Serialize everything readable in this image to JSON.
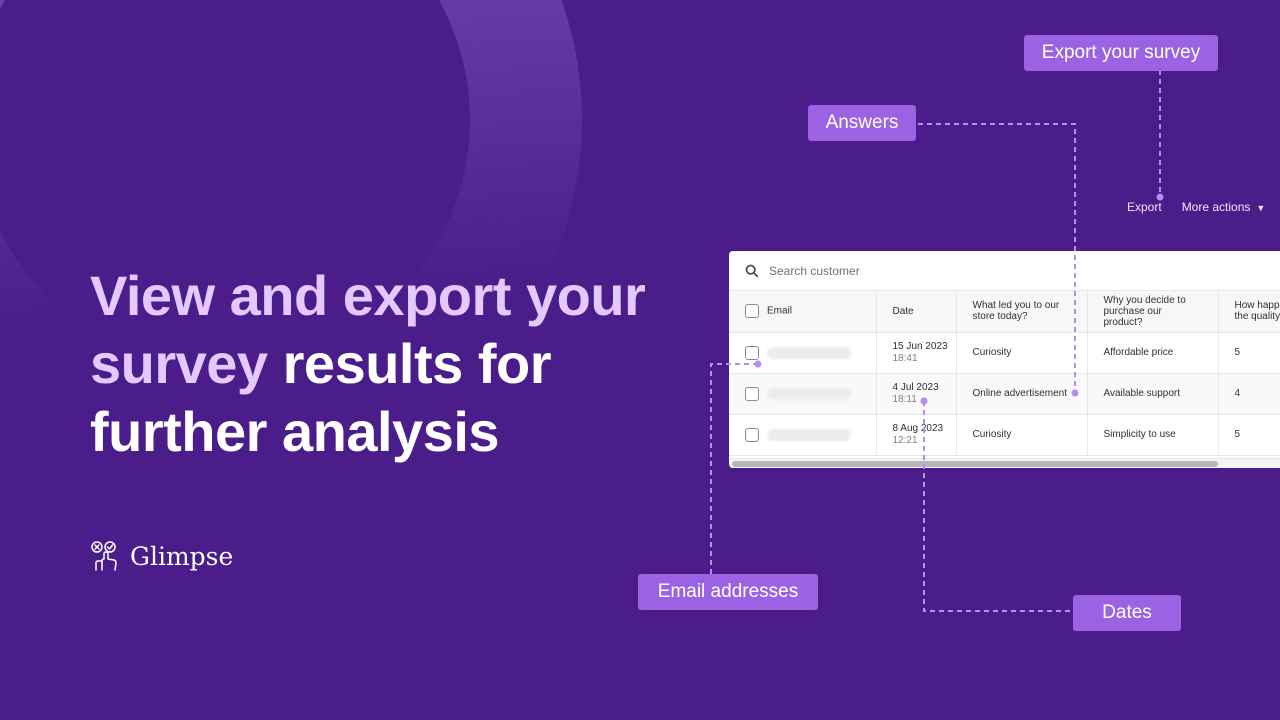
{
  "headline": {
    "light_part": "View and export your survey",
    "bold_part": "results for further analysis"
  },
  "brand": {
    "name": "Glimpse",
    "icon": "pointer-hand-icon"
  },
  "colors": {
    "background": "#4b1d8a",
    "accent": "#9b63e3",
    "headline_light": "#e3c9ff",
    "headline_bold": "#ffffff"
  },
  "callouts": {
    "export": "Export your survey",
    "answers": "Answers",
    "emails": "Email addresses",
    "dates": "Dates"
  },
  "actions": {
    "export_label": "Export",
    "more_actions_label": "More actions"
  },
  "table": {
    "search_placeholder": "Search customer",
    "columns": [
      "Email",
      "Date",
      "What led you to our store today?",
      "Why you decide to purchase our product?",
      "How happ the quality"
    ],
    "rows": [
      {
        "email": "",
        "date": "15 Jun 2023",
        "time": "18:41",
        "q1": "Curiosity",
        "q2": "Affordable price",
        "q3": "5"
      },
      {
        "email": "",
        "date": "4 Jul 2023",
        "time": "18:11",
        "q1": "Online advertisement",
        "q2": "Available support",
        "q3": "4"
      },
      {
        "email": "",
        "date": "8 Aug 2023",
        "time": "12:21",
        "q1": "Curiosity",
        "q2": "Simplicity to use",
        "q3": "5"
      }
    ]
  }
}
